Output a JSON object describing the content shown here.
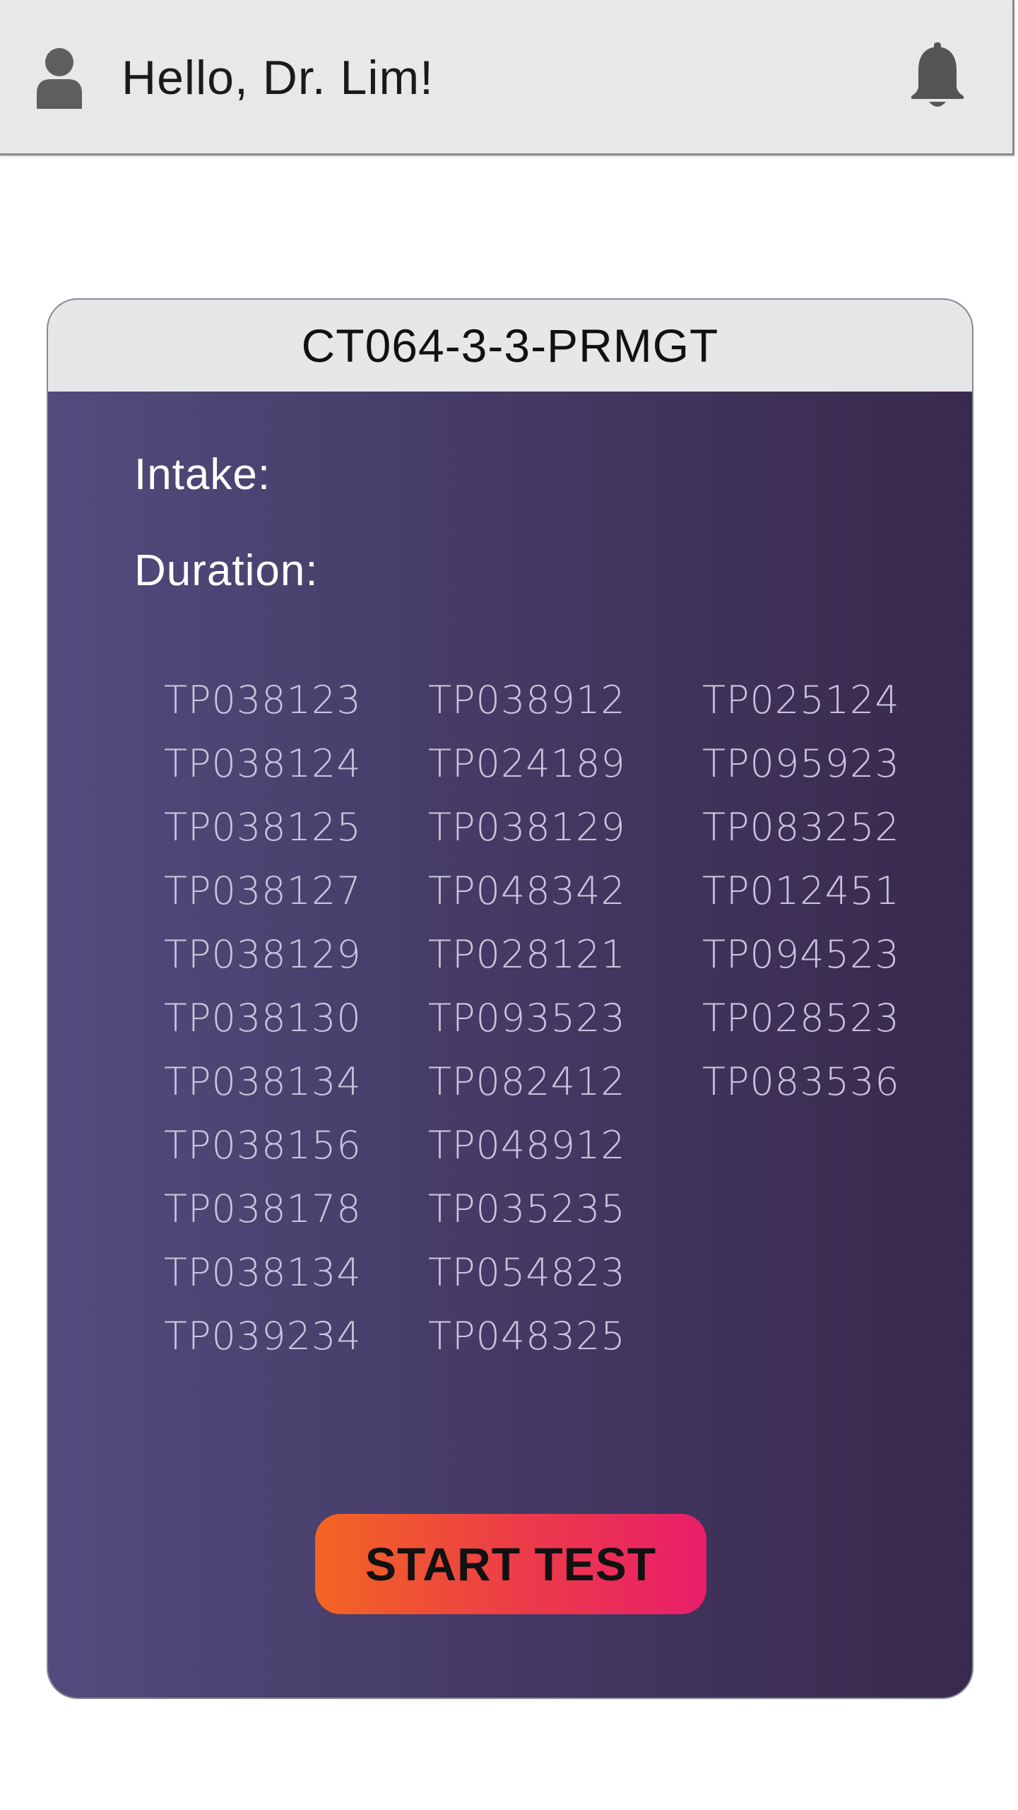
{
  "header": {
    "greeting": "Hello, Dr. Lim!",
    "avatar_icon": "user-avatar-icon",
    "notification_icon": "bell-icon"
  },
  "card": {
    "title": "CT064-3-3-PRMGT",
    "intake_label": "Intake:",
    "duration_label": "Duration:",
    "student_columns": [
      [
        "TP038123",
        "TP038124",
        "TP038125",
        "TP038127",
        "TP038129",
        "TP038130",
        "TP038134",
        "TP038156",
        "TP038178",
        "TP038134",
        "TP039234"
      ],
      [
        "TP038912",
        "TP024189",
        "TP038129",
        "TP048342",
        "TP028121",
        "TP093523",
        "TP082412",
        "TP048912",
        "TP035235",
        "TP054823",
        "TP048325"
      ],
      [
        "TP025124",
        "TP095923",
        "TP083252",
        "TP012451",
        "TP094523",
        "TP028523",
        "TP083536"
      ]
    ],
    "start_button_label": "START TEST"
  },
  "colors": {
    "header_bg": "#e7e8ea",
    "card_gradient_start": "#534b7d",
    "card_gradient_end": "#392a4d",
    "button_gradient_start": "#f26522",
    "button_gradient_end": "#e91e6a",
    "code_text": "#c9c4dc"
  }
}
